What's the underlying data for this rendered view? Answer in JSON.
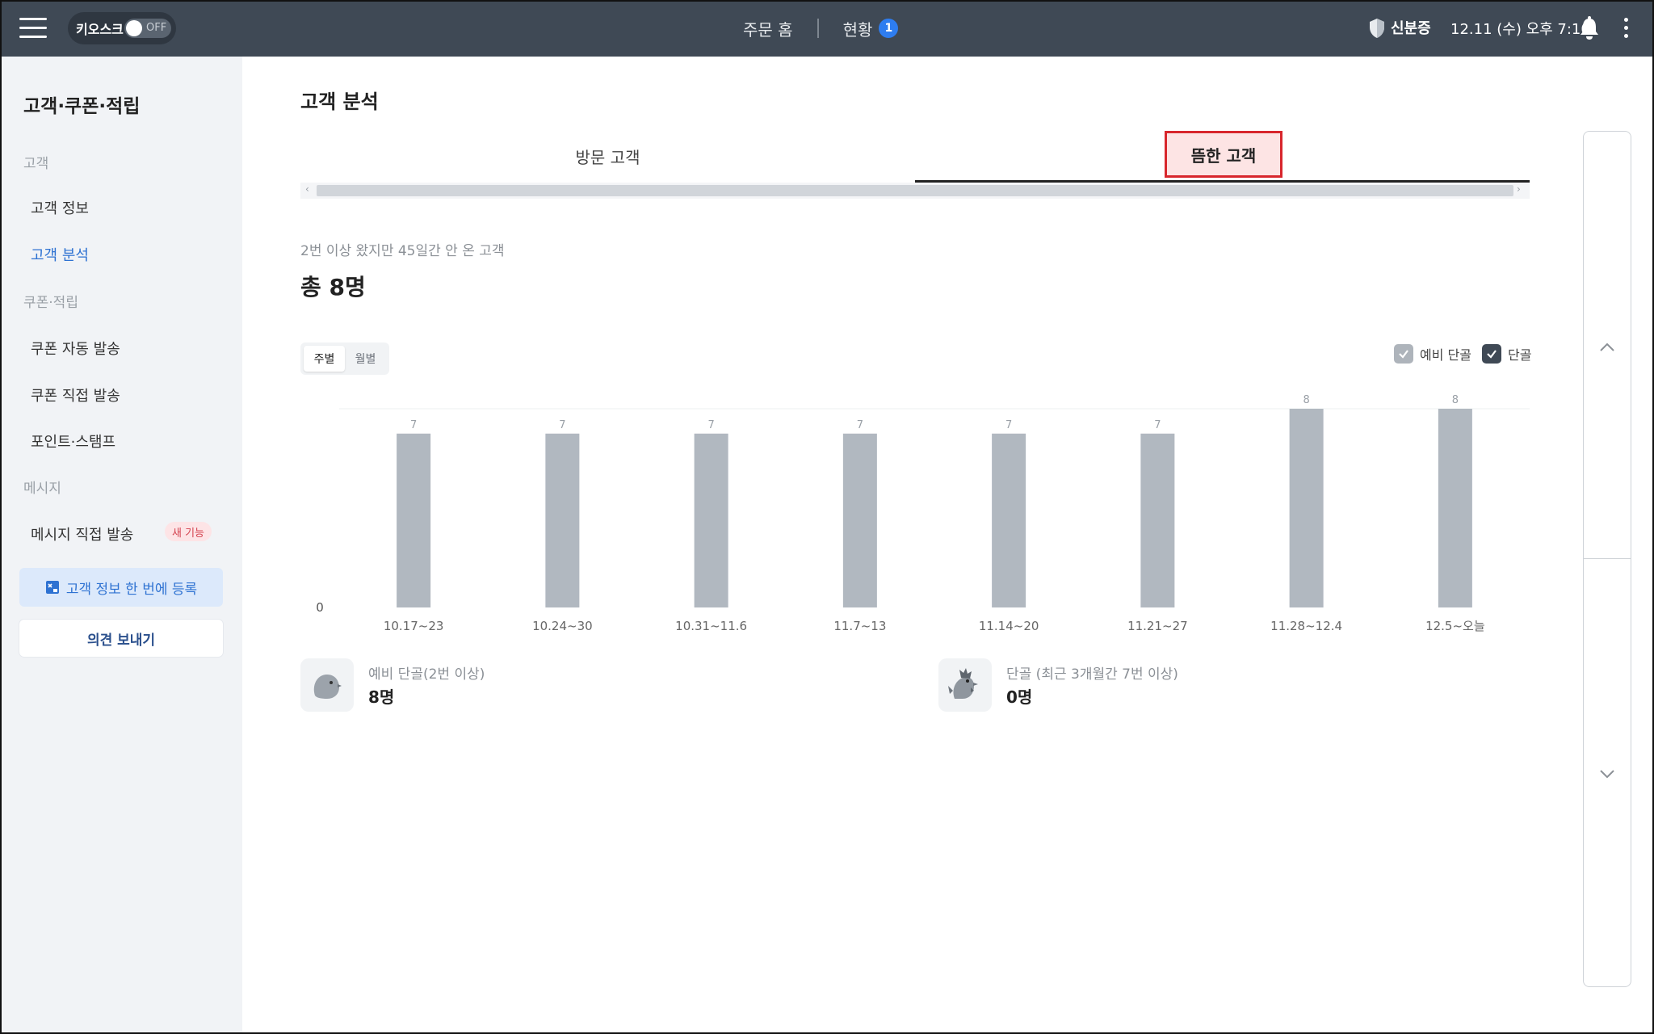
{
  "topbar": {
    "kiosk_label": "키오스크",
    "kiosk_state": "OFF",
    "nav_home": "주문 홈",
    "nav_status": "현황",
    "nav_status_badge": "1",
    "security_label": "신분증",
    "datetime": "12.11 (수) 오후 7:10"
  },
  "sidebar": {
    "title": "고객·쿠폰·적립",
    "section_customer": "고객",
    "item_customer_info": "고객 정보",
    "item_customer_analysis": "고객 분석",
    "section_coupon": "쿠폰·적립",
    "item_coupon_auto": "쿠폰 자동 발송",
    "item_coupon_direct": "쿠폰 직접 발송",
    "item_points": "포인트·스탬프",
    "section_message": "메시지",
    "item_message_direct": "메시지 직접 발송",
    "new_badge": "새 기능",
    "register_button": "고객 정보 한 번에 등록",
    "feedback_button": "의견 보내기"
  },
  "main": {
    "title": "고객 분석",
    "tab_visit": "방문 고객",
    "tab_lapsed": "뜸한 고객",
    "description": "2번 이상 왔지만 45일간 안 온 고객",
    "total": "총 8명",
    "period_weekly": "주별",
    "period_monthly": "월별",
    "legend_prospect": "예비 단골",
    "legend_regular": "단골",
    "stat_prospect_label": "예비 단골(2번 이상)",
    "stat_prospect_value": "8명",
    "stat_regular_label": "단골 (최근 3개월간 7번 이상)",
    "stat_regular_value": "0명"
  },
  "colors": {
    "topbar": "#3f4955",
    "accent": "#2e72d2",
    "bar": "#b1b8c0",
    "highlight_border": "#d8262c",
    "highlight_fill": "#fde4e4"
  },
  "chart_data": {
    "type": "bar",
    "categories": [
      "10.17~23",
      "10.24~30",
      "10.31~11.6",
      "11.7~13",
      "11.14~20",
      "11.21~27",
      "11.28~12.4",
      "12.5~오늘"
    ],
    "series": [
      {
        "name": "예비 단골",
        "values": [
          7,
          7,
          7,
          7,
          7,
          7,
          8,
          8
        ]
      },
      {
        "name": "단골",
        "values": [
          0,
          0,
          0,
          0,
          0,
          0,
          0,
          0
        ]
      }
    ],
    "y_tick_labels": [
      "0"
    ],
    "ylim": [
      0,
      8
    ],
    "grid": false,
    "legend": "top-right",
    "data_labels": true
  }
}
